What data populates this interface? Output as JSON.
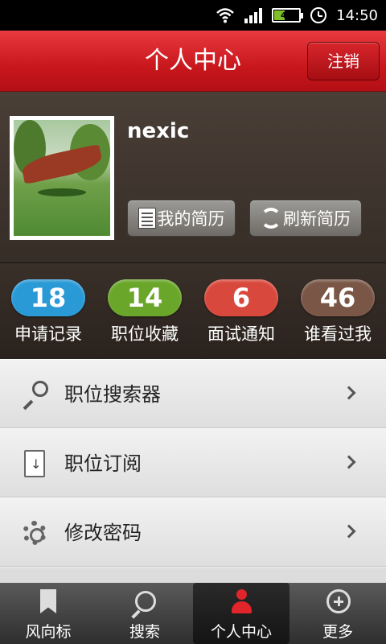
{
  "status_bar": {
    "battery_level": "40",
    "time": "14:50"
  },
  "header": {
    "title": "个人中心",
    "logout_label": "注销"
  },
  "profile": {
    "username": "nexic",
    "my_resume_label": "我的简历",
    "refresh_resume_label": "刷新简历"
  },
  "stats": [
    {
      "count": "18",
      "label": "申请记录",
      "color": "#2a9ad6"
    },
    {
      "count": "14",
      "label": "职位收藏",
      "color": "#6aa62a"
    },
    {
      "count": "6",
      "label": "面试通知",
      "color": "#d9483c"
    },
    {
      "count": "46",
      "label": "谁看过我",
      "color": "#7a5647"
    }
  ],
  "menu": [
    {
      "label": "职位搜索器",
      "icon": "magnifier-icon"
    },
    {
      "label": "职位订阅",
      "icon": "subscribe-icon"
    },
    {
      "label": "修改密码",
      "icon": "gear-icon"
    }
  ],
  "tabs": [
    {
      "label": "风向标",
      "icon": "bookmark-icon"
    },
    {
      "label": "搜索",
      "icon": "search-icon"
    },
    {
      "label": "个人中心",
      "icon": "person-icon",
      "active": true
    },
    {
      "label": "更多",
      "icon": "plus-icon"
    }
  ]
}
